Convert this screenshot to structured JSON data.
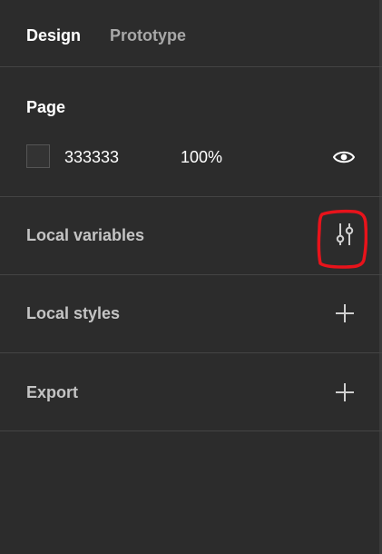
{
  "tabs": [
    {
      "label": "Design"
    },
    {
      "label": "Prototype"
    }
  ],
  "page": {
    "title": "Page",
    "color_hex": "333333",
    "opacity": "100%"
  },
  "sections": [
    {
      "label": "Local variables",
      "icon": "sliders-icon"
    },
    {
      "label": "Local styles",
      "icon": "plus-icon"
    },
    {
      "label": "Export",
      "icon": "plus-icon"
    }
  ],
  "colors": {
    "panel_bg": "#2c2c2c",
    "divider": "#444444",
    "annotation": "#e8131b"
  }
}
